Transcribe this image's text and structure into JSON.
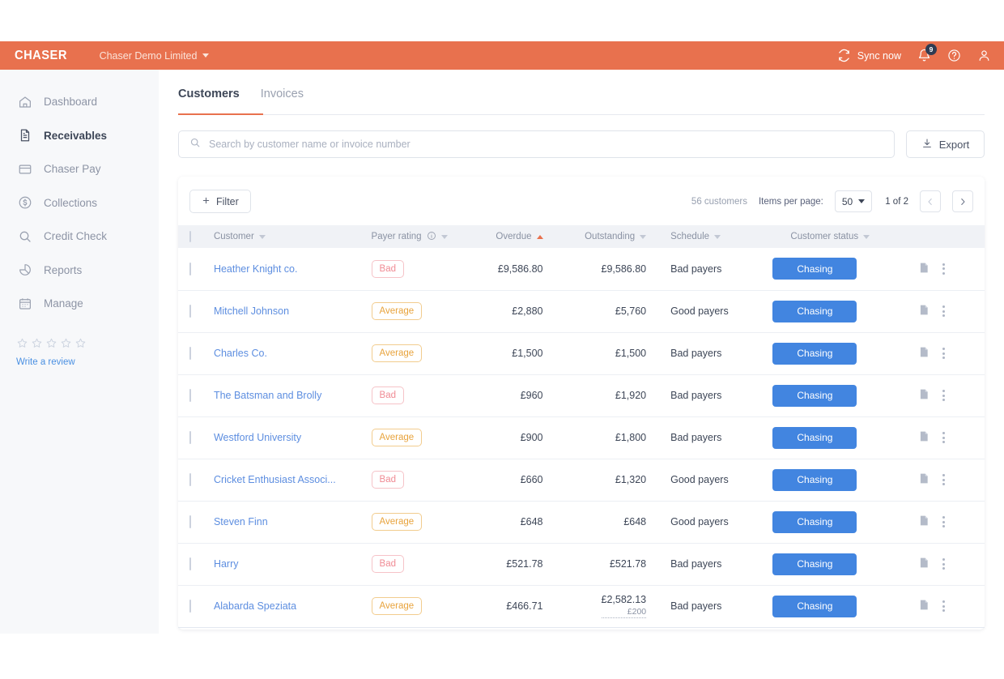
{
  "header": {
    "logo": "CHASER",
    "org_name": "Chaser Demo Limited",
    "sync_label": "Sync now",
    "notification_count": "9"
  },
  "sidebar": {
    "items": [
      {
        "label": "Dashboard",
        "icon": "home-icon",
        "active": false
      },
      {
        "label": "Receivables",
        "icon": "document-icon",
        "active": true
      },
      {
        "label": "Chaser Pay",
        "icon": "card-icon",
        "active": false
      },
      {
        "label": "Collections",
        "icon": "dollar-circle-icon",
        "active": false
      },
      {
        "label": "Credit Check",
        "icon": "magnifier-icon",
        "active": false
      },
      {
        "label": "Reports",
        "icon": "pie-chart-icon",
        "active": false
      },
      {
        "label": "Manage",
        "icon": "calendar-icon",
        "active": false
      }
    ],
    "review_link": "Write a review",
    "star_count": 5
  },
  "tabs": [
    {
      "label": "Customers",
      "active": true
    },
    {
      "label": "Invoices",
      "active": false
    }
  ],
  "search": {
    "placeholder": "Search by customer name or invoice number",
    "value": ""
  },
  "export_label": "Export",
  "toolbar": {
    "filter_label": "Filter",
    "count_label": "56 customers",
    "per_page_label": "Items per page:",
    "per_page_value": "50",
    "page_info": "1 of 2"
  },
  "table": {
    "columns": [
      {
        "label": "Customer",
        "sort": "none"
      },
      {
        "label": "Payer rating",
        "sort": "none",
        "info": true
      },
      {
        "label": "Overdue",
        "sort": "asc"
      },
      {
        "label": "Outstanding",
        "sort": "none"
      },
      {
        "label": "Schedule",
        "sort": "none"
      },
      {
        "label": "Customer status",
        "sort": "none"
      }
    ],
    "rows": [
      {
        "customer": "Heather Knight co.",
        "rating": "Bad",
        "rating_type": "bad",
        "overdue": "£9,586.80",
        "outstanding": "£9,586.80",
        "outstanding_sub": "",
        "schedule": "Bad payers",
        "status": "Chasing"
      },
      {
        "customer": "Mitchell Johnson",
        "rating": "Average",
        "rating_type": "average",
        "overdue": "£2,880",
        "outstanding": "£5,760",
        "outstanding_sub": "",
        "schedule": "Good payers",
        "status": "Chasing"
      },
      {
        "customer": "Charles Co.",
        "rating": "Average",
        "rating_type": "average",
        "overdue": "£1,500",
        "outstanding": "£1,500",
        "outstanding_sub": "",
        "schedule": "Bad payers",
        "status": "Chasing"
      },
      {
        "customer": "The Batsman and Brolly",
        "rating": "Bad",
        "rating_type": "bad",
        "overdue": "£960",
        "outstanding": "£1,920",
        "outstanding_sub": "",
        "schedule": "Bad payers",
        "status": "Chasing"
      },
      {
        "customer": "Westford University",
        "rating": "Average",
        "rating_type": "average",
        "overdue": "£900",
        "outstanding": "£1,800",
        "outstanding_sub": "",
        "schedule": "Bad payers",
        "status": "Chasing"
      },
      {
        "customer": "Cricket Enthusiast Associ...",
        "rating": "Bad",
        "rating_type": "bad",
        "overdue": "£660",
        "outstanding": "£1,320",
        "outstanding_sub": "",
        "schedule": "Good payers",
        "status": "Chasing"
      },
      {
        "customer": "Steven Finn",
        "rating": "Average",
        "rating_type": "average",
        "overdue": "£648",
        "outstanding": "£648",
        "outstanding_sub": "",
        "schedule": "Good payers",
        "status": "Chasing"
      },
      {
        "customer": "Harry",
        "rating": "Bad",
        "rating_type": "bad",
        "overdue": "£521.78",
        "outstanding": "£521.78",
        "outstanding_sub": "",
        "schedule": "Bad payers",
        "status": "Chasing"
      },
      {
        "customer": "Alabarda Speziata",
        "rating": "Average",
        "rating_type": "average",
        "overdue": "£466.71",
        "outstanding": "£2,582.13",
        "outstanding_sub": "£200",
        "schedule": "Bad payers",
        "status": "Chasing"
      }
    ]
  },
  "colors": {
    "brand_orange": "#E8714E",
    "accent_blue": "#4285e0",
    "link_blue": "#5d8ee0",
    "bad": "#f08b94",
    "average": "#e8a33c"
  }
}
